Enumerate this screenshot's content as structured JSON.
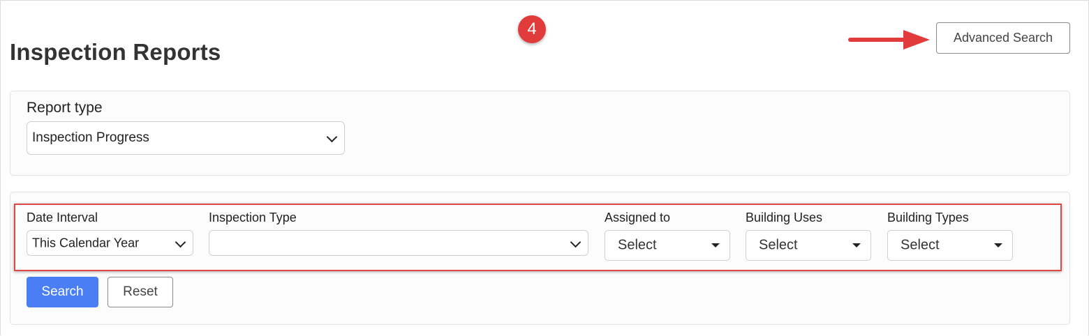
{
  "page": {
    "title": "Inspection Reports",
    "step_badge": "4",
    "advanced_search_label": "Advanced Search"
  },
  "report_type": {
    "label": "Report type",
    "value": "Inspection Progress"
  },
  "filters": {
    "date_interval": {
      "label": "Date Interval",
      "value": "This Calendar Year"
    },
    "inspection_type": {
      "label": "Inspection Type",
      "value": ""
    },
    "assigned_to": {
      "label": "Assigned to",
      "value": "Select"
    },
    "building_uses": {
      "label": "Building Uses",
      "value": "Select"
    },
    "building_types": {
      "label": "Building Types",
      "value": "Select"
    }
  },
  "actions": {
    "search_label": "Search",
    "reset_label": "Reset"
  },
  "colors": {
    "accent_primary": "#4a7ef5",
    "annotation_red": "#e04848"
  }
}
